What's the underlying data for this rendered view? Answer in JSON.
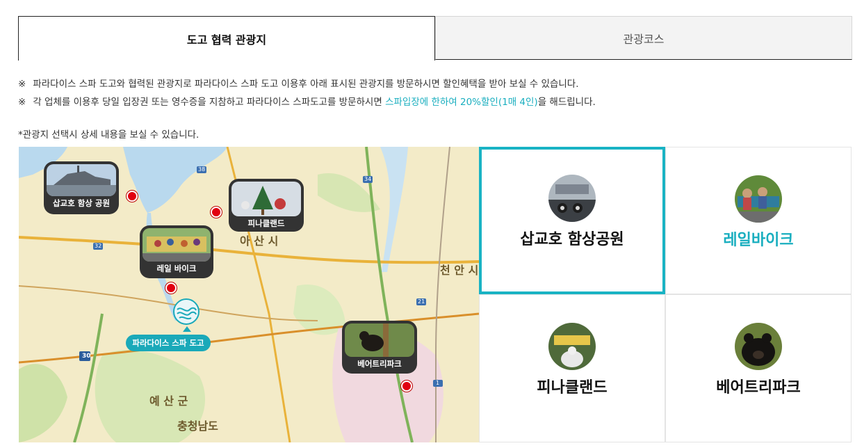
{
  "tabs": [
    {
      "label": "도고 협력 관광지",
      "active": true
    },
    {
      "label": "관광코스",
      "active": false
    }
  ],
  "notes": {
    "mark": "※",
    "line1": "파라다이스 스파 도고와 협력된 관광지로 파라다이스 스파 도고 이용후 아래 표시된 관광지를 방문하시면 할인혜택을 받아 보실 수 있습니다.",
    "line2_before": "각 업체를 이용후 당일 입장권 또는 영수증을 지참하고 파라다이스 스파도고를 방문하시면 ",
    "line2_highlight": "스파입장에 한하여 20%할인(1매 4인)",
    "line2_after": "을 해드립니다.",
    "hint": "*관광지 선택시 상세 내용을 보실 수 있습니다."
  },
  "map": {
    "callouts": {
      "sapgyoho": "삽교호 함상 공원",
      "pinacle": "피나클랜드",
      "railbike": "레일 바이크",
      "beartree": "베어트리파크"
    },
    "spa_label": "파라다이스 스파 도고",
    "regions": {
      "asan": "아 산 시",
      "cheonan": "천 안 시",
      "yesan": "예 산 군",
      "chungnam": "충청남도"
    },
    "route_numbers": {
      "r38": "38",
      "r32": "32",
      "r21": "21",
      "r30": "30",
      "r34": "34",
      "r1": "1"
    }
  },
  "cards": [
    {
      "label": "삽교호 함상공원",
      "selected": true,
      "highlighted": false
    },
    {
      "label": "레일바이크",
      "selected": false,
      "highlighted": true
    },
    {
      "label": "피나클랜드",
      "selected": false,
      "highlighted": false
    },
    {
      "label": "베어트리파크",
      "selected": false,
      "highlighted": false
    }
  ],
  "colors": {
    "accent": "#19aebf",
    "pin": "#e10010",
    "callout_bg": "#333333",
    "map_land": "#f4ecc9",
    "map_water": "#b9d9ee"
  }
}
